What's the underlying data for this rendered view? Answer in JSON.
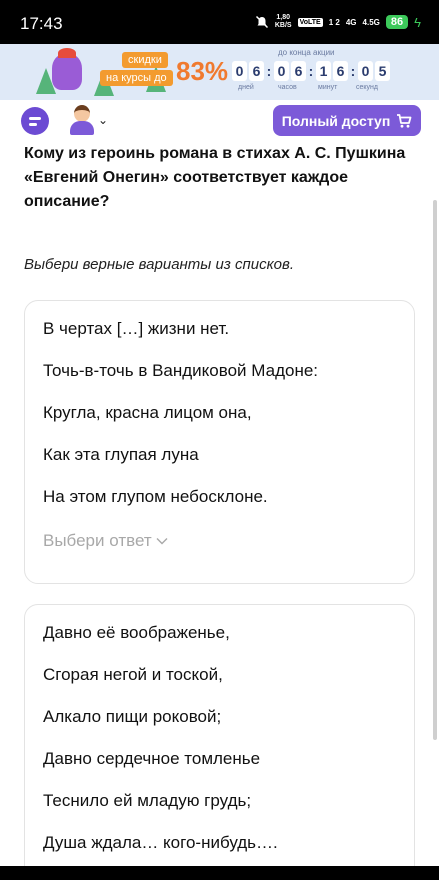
{
  "status_bar": {
    "time": "17:43",
    "speed_value": "1,80",
    "speed_unit": "KB/S",
    "volte": "VoLTE",
    "sim_slots": "1 2",
    "net1": "4G",
    "net2": "4.5G",
    "battery": "86"
  },
  "promo": {
    "tag_top": "скидки",
    "tag_bottom": "на курсы до",
    "percent": "83%",
    "caption": "до конца акции",
    "digits": [
      "0",
      "6",
      "0",
      "6",
      "1",
      "6",
      "0",
      "5"
    ],
    "labels": [
      "дней",
      "часов",
      "минут",
      "секунд"
    ]
  },
  "header": {
    "full_access_label": "Полный доступ",
    "chevron": "⌄"
  },
  "question": {
    "title": "Кому из героинь романа в стихах А. С. Пушкина «Евгений Онегин» соответствует каждое описание?",
    "instruction": "Выбери верные варианты из списков."
  },
  "cards": [
    {
      "lines": [
        "В чертах […] жизни нет.",
        "Точь-в-точь в Вандиковой Мадоне:",
        "Кругла, красна лицом она,",
        "Как эта глупая луна",
        "На этом глупом небосклоне."
      ],
      "choose_label": "Выбери ответ"
    },
    {
      "lines": [
        "Давно её воображенье,",
        "Сгорая негой и тоской,",
        "Алкало пищи роковой;",
        "Давно сердечное томленье",
        "Теснило ей младую грудь;",
        "Душа ждала… кого-нибудь…."
      ]
    }
  ],
  "colors": {
    "accent": "#7c5ad8",
    "promo_orange": "#f07a2f",
    "battery_green": "#3cc95a"
  }
}
